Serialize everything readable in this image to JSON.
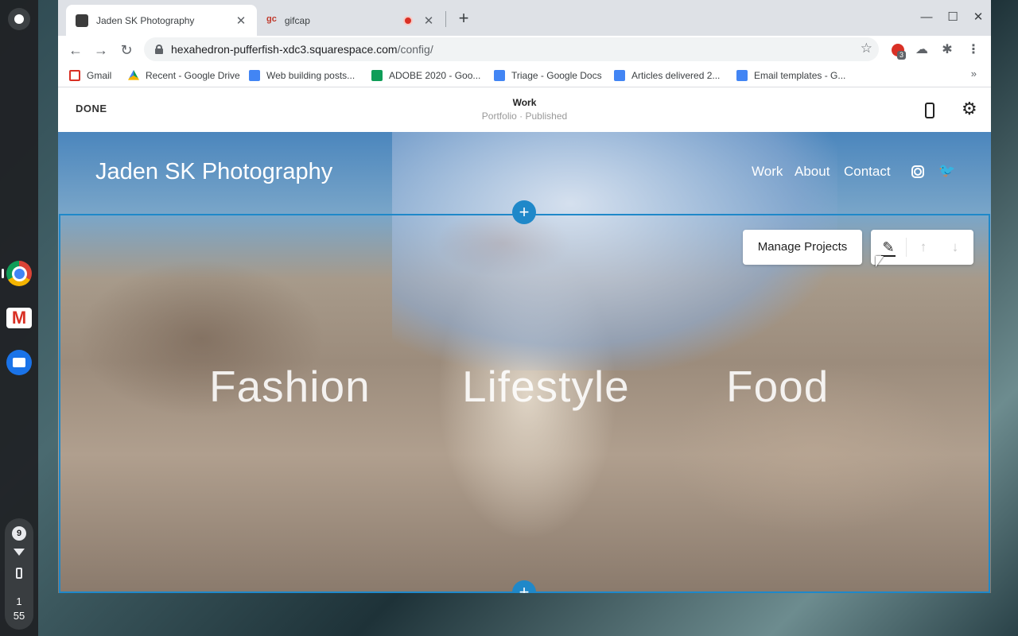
{
  "shelf": {
    "status_count": "9",
    "time_hour": "1",
    "time_min": "55"
  },
  "tabs": [
    {
      "title": "Jaden SK Photography",
      "close": "✕"
    },
    {
      "favicon_text": "gc",
      "title": "gifcap",
      "close": "✕"
    }
  ],
  "window": {
    "new_tab": "+",
    "minimize": "—",
    "maximize": "☐",
    "close": "✕"
  },
  "toolbar": {
    "back": "←",
    "forward": "→",
    "reload": "↻",
    "url_host": "hexahedron-pufferfish-xdc3.squarespace.com",
    "url_path": "/config/",
    "star": "☆",
    "ext_badge": "3",
    "cloud": "☁",
    "puzzle": "✱",
    "menu": "⋮"
  },
  "bookmarks": [
    {
      "label": "Gmail",
      "icon": "gmail-icon"
    },
    {
      "label": "Recent - Google Drive",
      "icon": "drive-icon"
    },
    {
      "label": "Web building posts...",
      "icon": "doc-icon"
    },
    {
      "label": "ADOBE 2020 - Goo...",
      "icon": "sheet-icon"
    },
    {
      "label": "Triage - Google Docs",
      "icon": "doc-icon"
    },
    {
      "label": "Articles delivered 2...",
      "icon": "doc-icon"
    },
    {
      "label": "Email templates - G...",
      "icon": "doc-icon"
    }
  ],
  "bookmarks_more": "»",
  "editor": {
    "done": "DONE",
    "page_title": "Work",
    "page_subtitle": "Portfolio · Published",
    "gear": "⚙"
  },
  "site": {
    "title": "Jaden SK Photography",
    "nav": [
      "Work",
      "About",
      "Contact"
    ],
    "twitter": "🐦",
    "add": "+",
    "manage_projects": "Manage Projects",
    "pencil": "✎",
    "up": "↑",
    "down": "↓",
    "categories": [
      "Fashion",
      "Lifestyle",
      "Food"
    ]
  }
}
